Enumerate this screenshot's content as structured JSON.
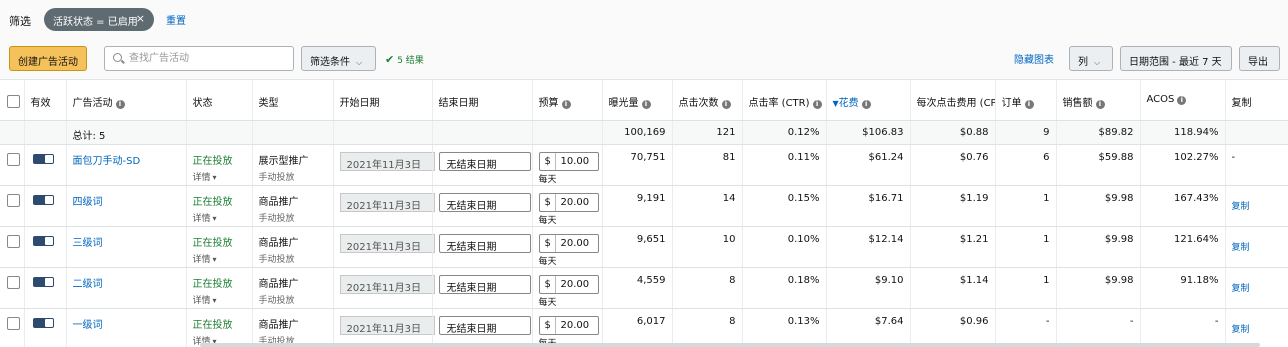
{
  "filter": {
    "label": "筛选",
    "chip": "活跃状态 = 已启用",
    "chip_close": "×",
    "reset": "重置"
  },
  "toolbar": {
    "create": "创建广告活动",
    "search_placeholder": "查找广告活动",
    "conditions": "筛选条件",
    "results": "5 结果",
    "hide_chart": "隐藏图表",
    "columns": "列",
    "date_range": "日期范围 - 最近 7 天",
    "export": "导出"
  },
  "headers": {
    "active": "有效",
    "campaign": "广告活动",
    "status": "状态",
    "type": "类型",
    "start": "开始日期",
    "end": "结束日期",
    "budget": "预算",
    "impressions": "曝光量",
    "clicks": "点击次数",
    "ctr": "点击率 (CTR)",
    "spend": "花费",
    "cpc": "每次点击费用 (CPC)",
    "orders": "订单",
    "sales": "销售额",
    "acos": "ACOS",
    "copy": "复制"
  },
  "totals": {
    "label": "总计: 5",
    "impressions": "100,169",
    "clicks": "121",
    "ctr": "0.12%",
    "spend": "$106.83",
    "cpc": "$0.88",
    "orders": "9",
    "sales": "$89.82",
    "acos": "118.94%"
  },
  "rows": [
    {
      "name": "面包刀手动-SD",
      "status": "正在投放",
      "detail": "详情",
      "type": "展示型推广",
      "targeting": "手动投放",
      "start": "2021年11月3日",
      "end": "无结束日期",
      "currency": "$",
      "budget": "10.00",
      "per_day": "每天",
      "impressions": "70,751",
      "clicks": "81",
      "ctr": "0.11%",
      "spend": "$61.24",
      "cpc": "$0.76",
      "orders": "6",
      "sales": "$59.88",
      "acos": "102.27%",
      "copy": "-"
    },
    {
      "name": "四级词",
      "status": "正在投放",
      "detail": "详情",
      "type": "商品推广",
      "targeting": "手动投放",
      "start": "2021年11月3日",
      "end": "无结束日期",
      "currency": "$",
      "budget": "20.00",
      "per_day": "每天",
      "impressions": "9,191",
      "clicks": "14",
      "ctr": "0.15%",
      "spend": "$16.71",
      "cpc": "$1.19",
      "orders": "1",
      "sales": "$9.98",
      "acos": "167.43%",
      "copy": "复制"
    },
    {
      "name": "三级词",
      "status": "正在投放",
      "detail": "详情",
      "type": "商品推广",
      "targeting": "手动投放",
      "start": "2021年11月3日",
      "end": "无结束日期",
      "currency": "$",
      "budget": "20.00",
      "per_day": "每天",
      "impressions": "9,651",
      "clicks": "10",
      "ctr": "0.10%",
      "spend": "$12.14",
      "cpc": "$1.21",
      "orders": "1",
      "sales": "$9.98",
      "acos": "121.64%",
      "copy": "复制"
    },
    {
      "name": "二级词",
      "status": "正在投放",
      "detail": "详情",
      "type": "商品推广",
      "targeting": "手动投放",
      "start": "2021年11月3日",
      "end": "无结束日期",
      "currency": "$",
      "budget": "20.00",
      "per_day": "每天",
      "impressions": "4,559",
      "clicks": "8",
      "ctr": "0.18%",
      "spend": "$9.10",
      "cpc": "$1.14",
      "orders": "1",
      "sales": "$9.98",
      "acos": "91.18%",
      "copy": "复制"
    },
    {
      "name": "一级词",
      "status": "正在投放",
      "detail": "详情",
      "type": "商品推广",
      "targeting": "手动投放",
      "start": "2021年11月3日",
      "end": "无结束日期",
      "currency": "$",
      "budget": "20.00",
      "per_day": "每天",
      "impressions": "6,017",
      "clicks": "8",
      "ctr": "0.13%",
      "spend": "$7.64",
      "cpc": "$0.96",
      "orders": "-",
      "sales": "-",
      "acos": "-",
      "copy": "复制"
    }
  ]
}
